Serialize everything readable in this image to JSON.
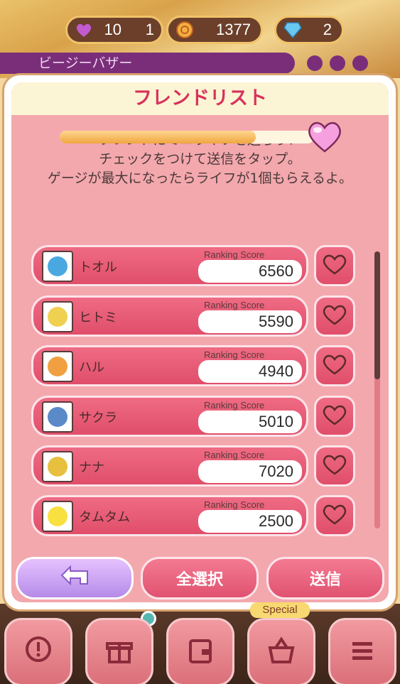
{
  "status_bar": {
    "lives": "10",
    "lives_extra": "1",
    "coins": "1377",
    "gems": "2"
  },
  "stage_title": "ビージーバザー",
  "modal": {
    "title": "フレンドリスト",
    "instructions": [
      "フレンドにミニライフを送ろう！",
      "チェックをつけて送信をタップ。",
      "ゲージが最大になったらライフが1個もらえるよ。"
    ],
    "gauge_fill": 0.77
  },
  "friends": [
    {
      "name": "トオル",
      "score_label": "Ranking Score",
      "score": "6560",
      "avatar_color": "#4aa8e0"
    },
    {
      "name": "ヒトミ",
      "score_label": "Ranking Score",
      "score": "5590",
      "avatar_color": "#f0d050"
    },
    {
      "name": "ハル",
      "score_label": "Ranking Score",
      "score": "4940",
      "avatar_color": "#f0a040"
    },
    {
      "name": "サクラ",
      "score_label": "Ranking Score",
      "score": "5010",
      "avatar_color": "#5a8ac8"
    },
    {
      "name": "ナナ",
      "score_label": "Ranking Score",
      "score": "7020",
      "avatar_color": "#e8c040"
    },
    {
      "name": "タムタム",
      "score_label": "Ranking Score",
      "score": "2500",
      "avatar_color": "#f8e040"
    }
  ],
  "buttons": {
    "select_all": "全選択",
    "send": "送信"
  },
  "nav": {
    "special_label": "Special"
  },
  "colors": {
    "accent": "#d8325c",
    "panel": "#f3a8ad",
    "card": "#e04e6a"
  }
}
